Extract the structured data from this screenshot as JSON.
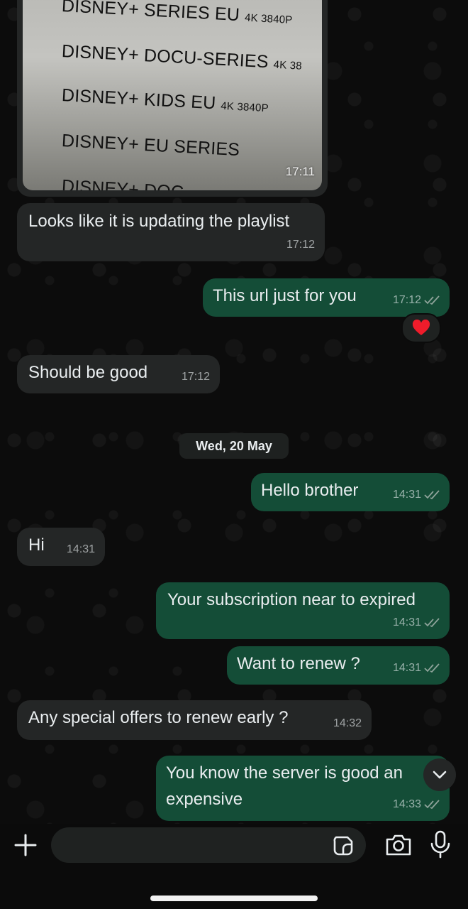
{
  "image_message": {
    "lines": [
      {
        "main": "DISNEY+ SERIES EU",
        "small": "4K 3840P"
      },
      {
        "main": "DISNEY+ DOCU-SERIES",
        "small": "4K 38"
      },
      {
        "main": "DISNEY+ KIDS EU",
        "small": "4K 3840P"
      },
      {
        "main": "DISNEY+ EU SERIES",
        "small": ""
      },
      {
        "main": "DISNEY+ DOC",
        "small": ""
      }
    ],
    "time": "17:11"
  },
  "messages": [
    {
      "direction": "incoming",
      "text": "Looks like it is updating the playlist",
      "time": "17:12"
    },
    {
      "direction": "outgoing",
      "text": "This url just for you",
      "time": "17:12",
      "reaction": "❤️"
    },
    {
      "direction": "incoming",
      "text": "Should be good",
      "time": "17:12"
    },
    {
      "direction": "outgoing",
      "text": "Hello brother",
      "time": "14:31"
    },
    {
      "direction": "incoming",
      "text": "Hi",
      "time": "14:31"
    },
    {
      "direction": "outgoing",
      "text": "Your subscription near to expired",
      "time": "14:31"
    },
    {
      "direction": "outgoing",
      "text": "Want to renew ?",
      "time": "14:31"
    },
    {
      "direction": "incoming",
      "text": "Any special offers to renew early ?",
      "time": "14:32"
    },
    {
      "direction": "outgoing",
      "text": "You know the server is good an expensive",
      "time": "14:33"
    }
  ],
  "date_separator": "Wed, 20 May",
  "composer": {
    "placeholder": ""
  },
  "icons": {
    "plus": "plus-icon",
    "sticker": "sticker-icon",
    "camera": "camera-icon",
    "mic": "microphone-icon",
    "scroll": "chevron-down-icon",
    "ticks": "double-check-icon"
  },
  "colors": {
    "incoming_bubble": "#242626",
    "outgoing_bubble": "#144d37",
    "background": "#0b0b0b",
    "read_ticks": "#8ea39a"
  }
}
